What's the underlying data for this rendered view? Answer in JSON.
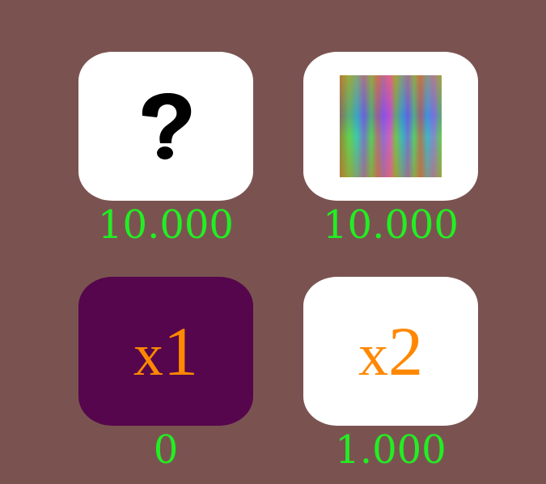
{
  "shop": {
    "items": [
      {
        "id": "mystery",
        "icon": "question-mark-icon",
        "price": "10.000",
        "selected": false
      },
      {
        "id": "rainbow",
        "icon": "rainbow-texture-icon",
        "price": "10.000",
        "selected": false
      },
      {
        "id": "x1",
        "label_x": "x",
        "label_n": "1",
        "price": "0",
        "selected": true
      },
      {
        "id": "x2",
        "label_x": "x",
        "label_n": "2",
        "price": "1.000",
        "selected": false
      }
    ]
  },
  "colors": {
    "background": "#7a5351",
    "tile": "#ffffff",
    "tile_selected": "#55064c",
    "price_text": "#22ee22",
    "multiplier_text": "#ff8800"
  }
}
